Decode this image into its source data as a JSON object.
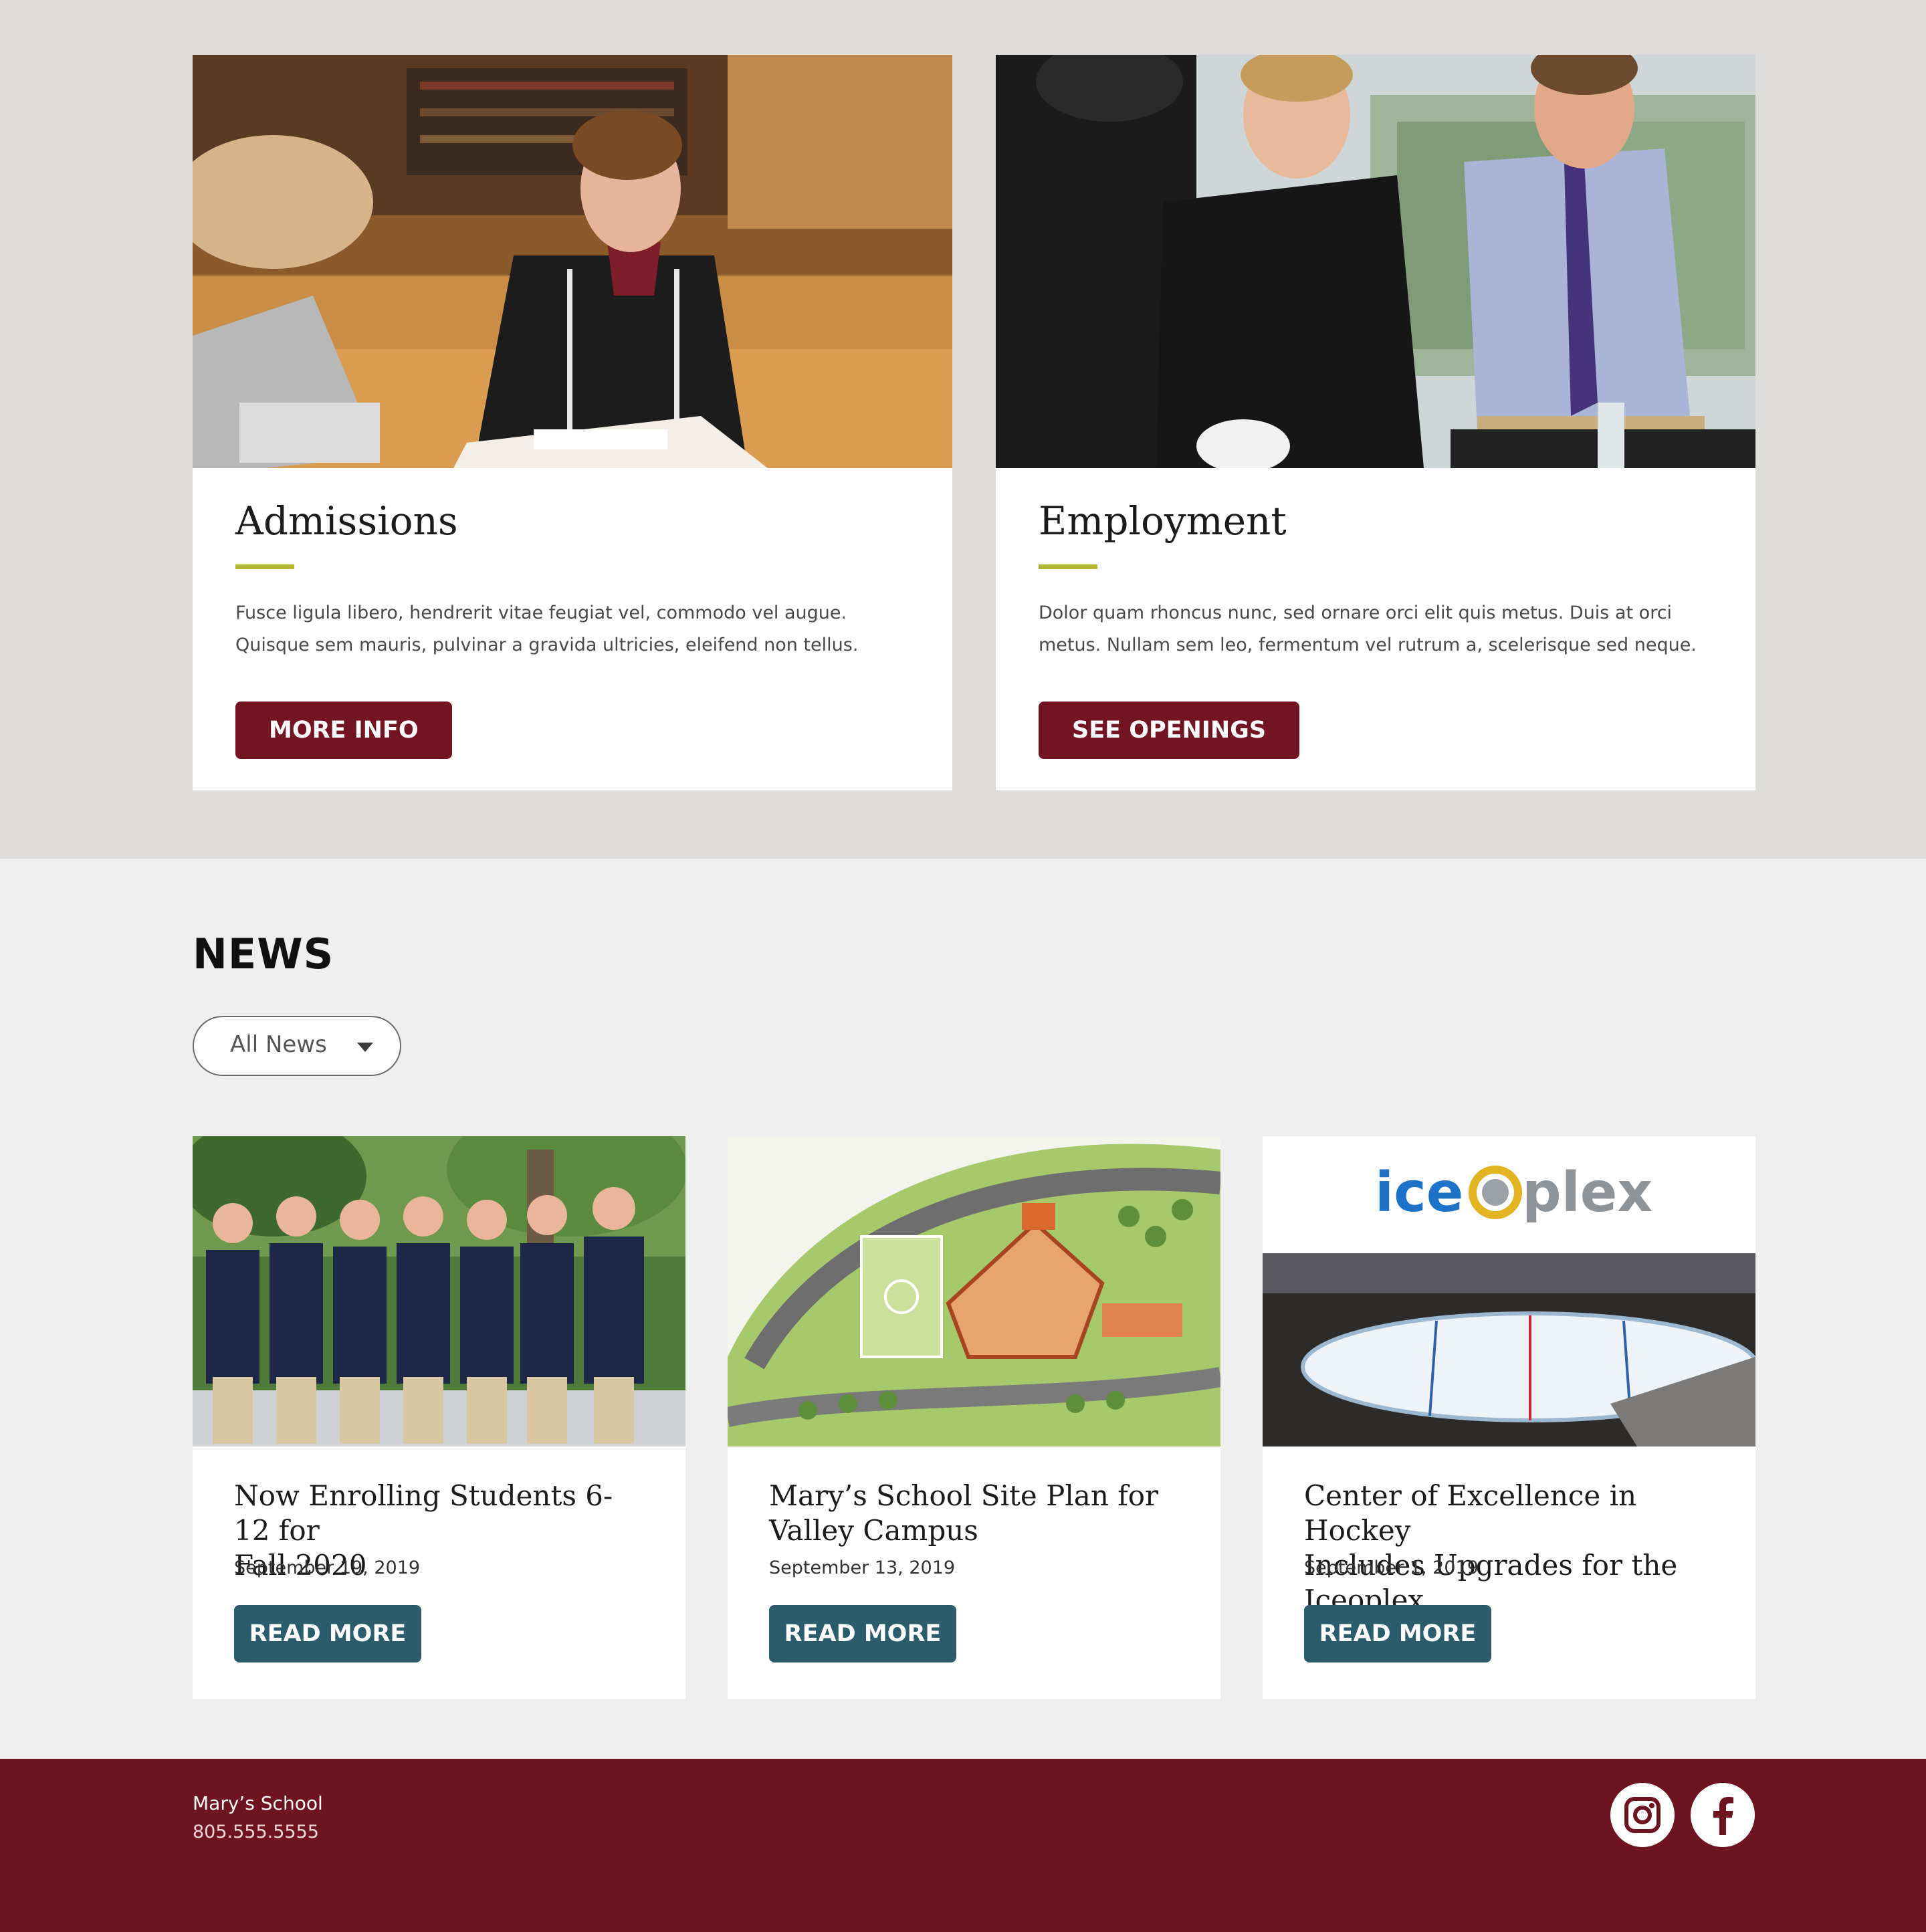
{
  "features": [
    {
      "title": "Admissions",
      "text_line1": "Fusce ligula libero, hendrerit vitae feugiat vel, commodo vel augue.",
      "text_line2": "Quisque sem mauris, pulvinar a gravida ultricies, eleifend non tellus.",
      "button": "MORE INFO"
    },
    {
      "title": "Employment",
      "text_line1": "Dolor quam rhoncus nunc, sed ornare orci elit quis metus. Duis at orci",
      "text_line2": "metus. Nullam sem leo, fermentum vel rutrum a, scelerisque sed neque.",
      "button": "SEE OPENINGS"
    }
  ],
  "news": {
    "heading": "NEWS",
    "filter": {
      "selected": "All News"
    },
    "items": [
      {
        "title_line1": "Now Enrolling Students 6-12 for",
        "title_line2": "Fall 2020",
        "date": "September 19, 2019",
        "button": "READ MORE"
      },
      {
        "title_line1": "Mary’s School Site Plan for",
        "title_line2": "Valley Campus",
        "date": "September 13, 2019",
        "button": "READ MORE"
      },
      {
        "title_line1": "Center of Excellence in Hockey",
        "title_line2": "Includes Upgrades for the Iceoplex",
        "date": "September 1, 2019",
        "button": "READ MORE",
        "logo_text_ice": "ice",
        "logo_text_plex": "plex"
      }
    ]
  },
  "footer": {
    "school_name": "Mary’s School",
    "phone": "805.555.5555",
    "social": [
      "instagram-icon",
      "facebook-icon"
    ]
  },
  "colors": {
    "maroon": "#731423",
    "teal": "#2b5c6b",
    "accent_green": "#b5b834",
    "footer": "#6e1421"
  }
}
